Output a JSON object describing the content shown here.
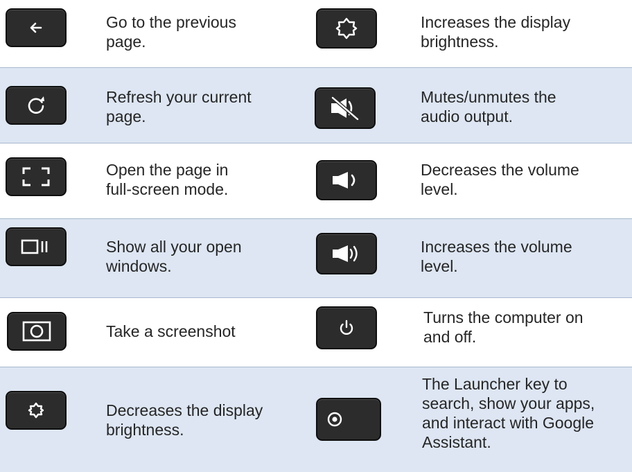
{
  "rows": [
    {
      "left": {
        "icon": "back-arrow-icon",
        "lines": [
          "Go to the previous",
          "page."
        ]
      },
      "right": {
        "icon": "brightness-up-icon",
        "lines": [
          "Increases the display",
          "brightness."
        ]
      }
    },
    {
      "left": {
        "icon": "refresh-icon",
        "lines": [
          "Refresh your current",
          "page."
        ]
      },
      "right": {
        "icon": "mute-icon",
        "lines": [
          "Mutes/unmutes the",
          "audio output."
        ]
      }
    },
    {
      "left": {
        "icon": "fullscreen-icon",
        "lines": [
          "Open the page in",
          "full-screen mode."
        ]
      },
      "right": {
        "icon": "volume-down-icon",
        "lines": [
          "Decreases the volume",
          "level."
        ]
      }
    },
    {
      "left": {
        "icon": "overview-icon",
        "lines": [
          "Show all your open",
          "windows."
        ]
      },
      "right": {
        "icon": "volume-up-icon",
        "lines": [
          "Increases the volume",
          "level."
        ]
      }
    },
    {
      "left": {
        "icon": "screenshot-icon",
        "lines": [
          "Take a screenshot"
        ]
      },
      "right": {
        "icon": "power-icon",
        "lines": [
          "Turns the computer on",
          "and off."
        ]
      }
    },
    {
      "left": {
        "icon": "brightness-down-icon",
        "lines": [
          "Decreases the display",
          "brightness."
        ]
      },
      "right": {
        "icon": "launcher-icon",
        "lines": [
          "The Launcher key to",
          "search, show your apps,",
          "and interact with Google",
          "Assistant."
        ]
      }
    }
  ]
}
